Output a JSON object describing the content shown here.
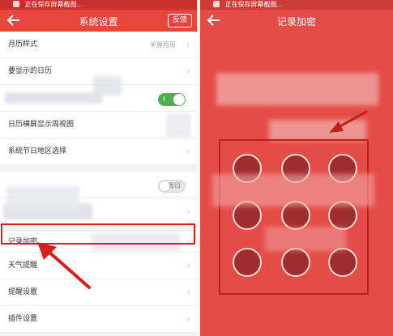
{
  "left_screen": {
    "status_text": "正在保存屏幕截图...",
    "title": "系统设置",
    "feedback_label": "反馈",
    "rows": [
      {
        "label": "月历样式",
        "value": "半屏月历"
      },
      {
        "label": "要显示的日历",
        "value": ""
      },
      {
        "label": "",
        "value": "",
        "toggle": "on"
      },
      {
        "label": "日历横屏显示周视图",
        "value": ""
      },
      {
        "label": "系统节日地区选择",
        "value": ""
      },
      {
        "label": "",
        "value": "",
        "toggle": "off"
      },
      {
        "label": "",
        "value": ""
      },
      {
        "label": "记录加密",
        "value": ""
      },
      {
        "label": "天气提醒",
        "value": ""
      },
      {
        "label": "提醒设置",
        "value": ""
      },
      {
        "label": "插件设置",
        "value": ""
      }
    ],
    "toggle_on_mark": "I",
    "toggle_off_mark": "周日"
  },
  "right_screen": {
    "status_text": "正在保存屏幕截图...",
    "title": "记录加密"
  },
  "colors": {
    "accent": "#e8453f",
    "annotation_red": "#d62020"
  }
}
